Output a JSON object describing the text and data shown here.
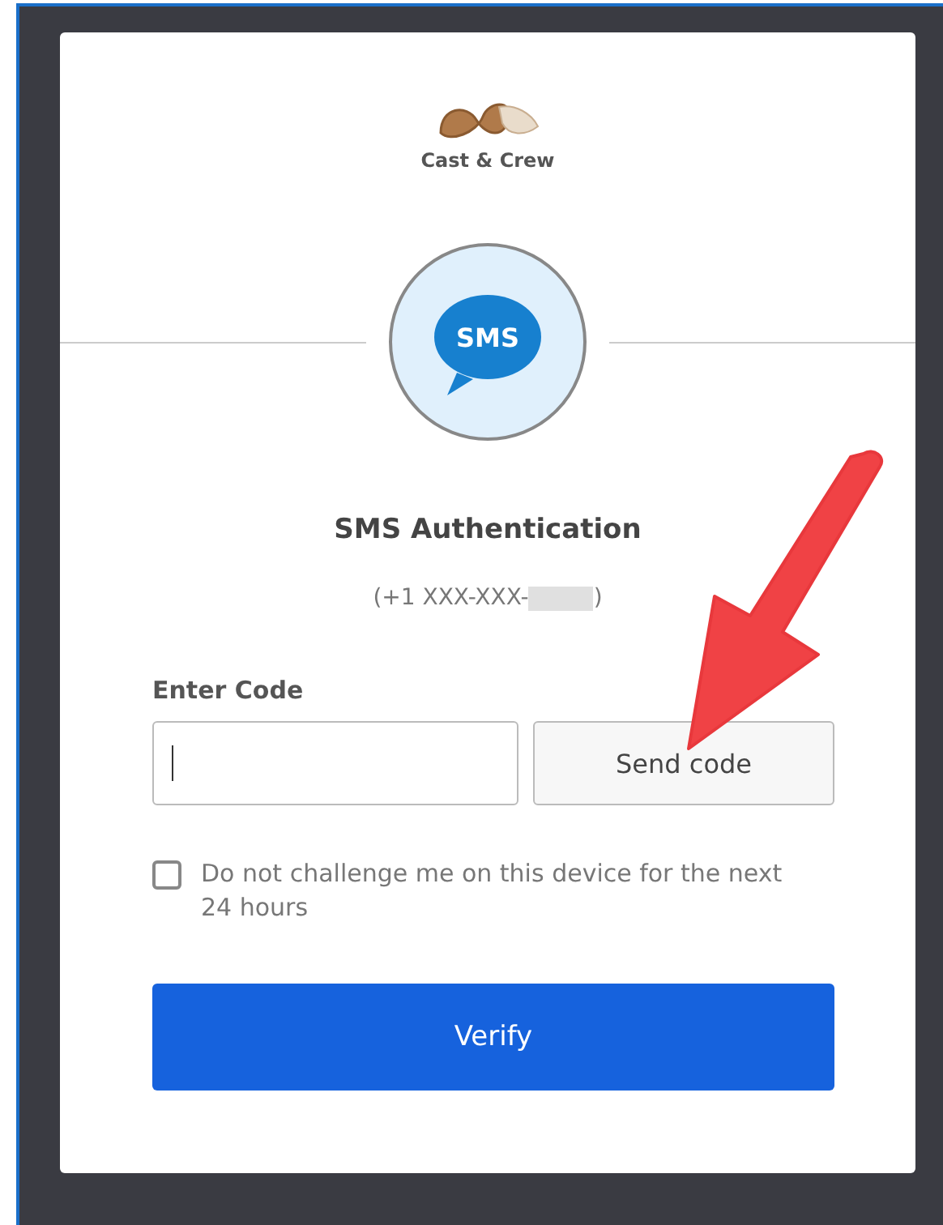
{
  "logo": {
    "text": "Cast & Crew"
  },
  "factor": {
    "badge": "SMS",
    "title": "SMS Authentication",
    "phone_prefix": "(+1 XXX-XXX-",
    "phone_suffix": ")",
    "redacted": true
  },
  "form": {
    "label": "Enter Code",
    "send_button": "Send code",
    "remember": {
      "label": "Do not challenge me on this device for the next 24 hours",
      "checked": false
    },
    "submit_button": "Verify"
  },
  "annotation": {
    "kind": "arrow"
  }
}
